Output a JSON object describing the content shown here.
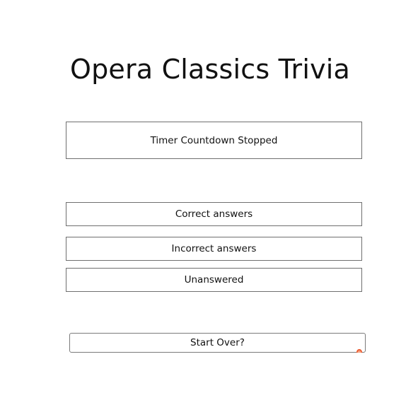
{
  "page": {
    "title": "Opera Classics Trivia"
  },
  "timer": {
    "status": "Timer Countdown Stopped"
  },
  "results": {
    "correct_label": "Correct answers",
    "incorrect_label": "Incorrect answers",
    "unanswered_label": "Unanswered"
  },
  "actions": {
    "start_over_label": "Start Over?"
  },
  "icons": {
    "button_overlay_icon": "grammar-check-icon"
  },
  "colors": {
    "border": "#6f6f6f",
    "text": "#111111",
    "icon_accent": "#e8552a"
  }
}
